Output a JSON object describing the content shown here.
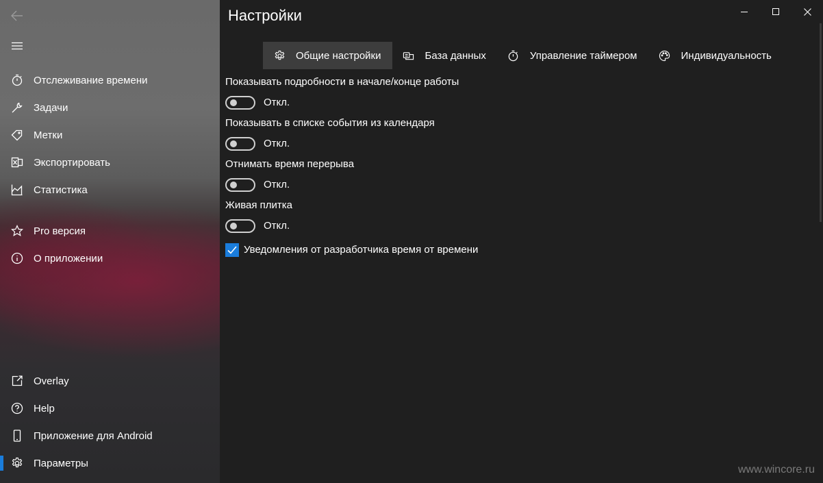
{
  "window": {
    "title": "Настройки"
  },
  "sidebar": {
    "top_items": [
      {
        "label": "Отслеживание времени",
        "icon": "stopwatch-icon"
      },
      {
        "label": "Задачи",
        "icon": "wrench-icon"
      },
      {
        "label": "Метки",
        "icon": "tag-icon"
      },
      {
        "label": "Экспортировать",
        "icon": "excel-icon"
      },
      {
        "label": "Статистика",
        "icon": "area-chart-icon"
      },
      {
        "label": "Pro версия",
        "icon": "star-icon"
      },
      {
        "label": "О приложении",
        "icon": "info-icon"
      }
    ],
    "bottom_items": [
      {
        "label": "Overlay",
        "icon": "overlay-icon"
      },
      {
        "label": "Help",
        "icon": "help-icon"
      },
      {
        "label": "Приложение для Android",
        "icon": "phone-icon"
      },
      {
        "label": "Параметры",
        "icon": "gear-icon",
        "selected": true
      }
    ]
  },
  "tabs": [
    {
      "label": "Общие настройки",
      "icon": "gear-icon",
      "active": true
    },
    {
      "label": "База данных",
      "icon": "database-icon"
    },
    {
      "label": "Управление таймером",
      "icon": "stopwatch-icon"
    },
    {
      "label": "Индивидуальность",
      "icon": "palette-icon"
    }
  ],
  "settings": [
    {
      "label": "Показывать подробности в начале/конце работы",
      "state": "Откл.",
      "on": false
    },
    {
      "label": "Показывать в списке события из календаря",
      "state": "Откл.",
      "on": false
    },
    {
      "label": "Отнимать время перерыва",
      "state": "Откл.",
      "on": false
    },
    {
      "label": "Живая плитка",
      "state": "Откл.",
      "on": false
    }
  ],
  "developer_notifications": {
    "label": "Уведомления от разработчика время от времени",
    "checked": true
  },
  "colors": {
    "accent": "#1a7ddc",
    "background": "#1f1f1f",
    "tab_active": "#3d3d3d"
  },
  "watermark": "www.wincore.ru"
}
